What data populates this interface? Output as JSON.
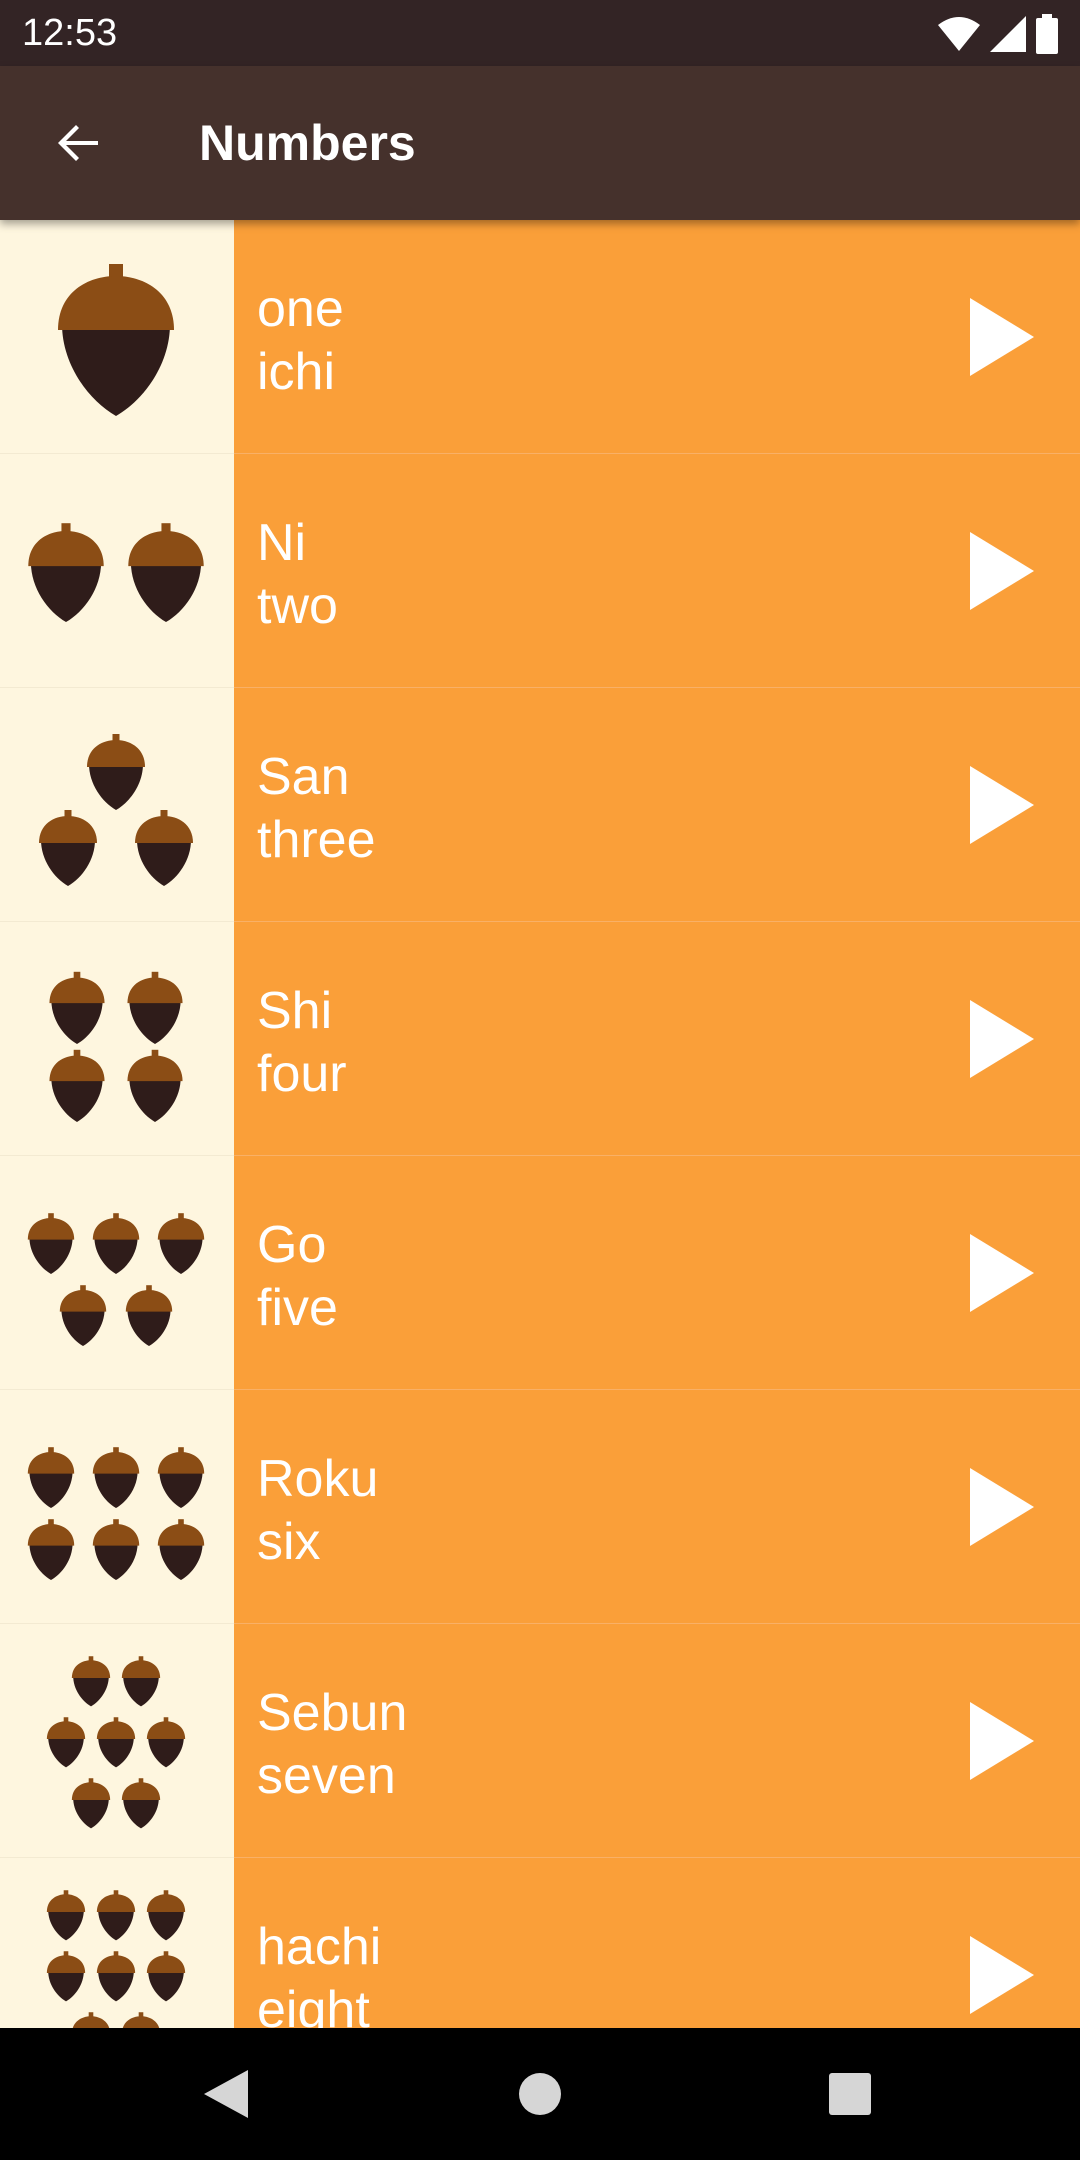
{
  "status_bar": {
    "time": "12:53",
    "icons": [
      "wifi-icon",
      "cellular-signal-icon",
      "battery-icon"
    ]
  },
  "app_bar": {
    "title": "Numbers",
    "back_icon": "arrow-back-icon"
  },
  "colors": {
    "status_bar": "#332425",
    "app_bar": "#45312c",
    "row": "#fa9f39",
    "image_bg": "#fef6df",
    "acorn_cap": "#8b4d15",
    "acorn_body": "#2f1c1a"
  },
  "items": [
    {
      "primary": "one",
      "secondary": "ichi",
      "count": 1,
      "play_icon": "play-icon"
    },
    {
      "primary": "Ni",
      "secondary": "two",
      "count": 2,
      "play_icon": "play-icon"
    },
    {
      "primary": "San",
      "secondary": "three",
      "count": 3,
      "play_icon": "play-icon"
    },
    {
      "primary": "Shi",
      "secondary": "four",
      "count": 4,
      "play_icon": "play-icon"
    },
    {
      "primary": "Go",
      "secondary": "five",
      "count": 5,
      "play_icon": "play-icon"
    },
    {
      "primary": "Roku",
      "secondary": "six",
      "count": 6,
      "play_icon": "play-icon"
    },
    {
      "primary": "Sebun",
      "secondary": "seven",
      "count": 7,
      "play_icon": "play-icon"
    },
    {
      "primary": "hachi",
      "secondary": "eight",
      "count": 8,
      "play_icon": "play-icon"
    }
  ],
  "nav_bar": {
    "buttons": [
      "back-triangle-icon",
      "home-circle-icon",
      "recents-square-icon"
    ]
  }
}
